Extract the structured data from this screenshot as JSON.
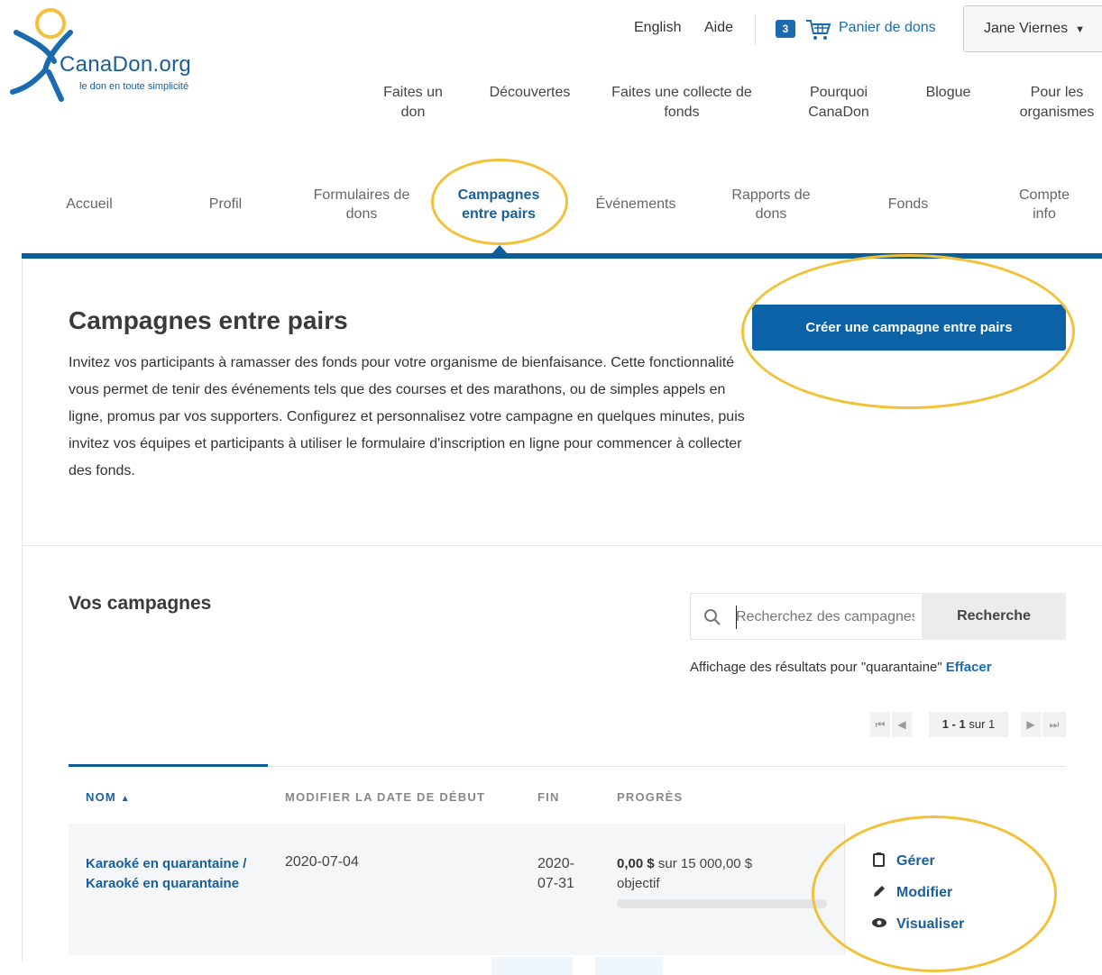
{
  "header": {
    "logo_name": "CanaDon.org",
    "logo_tagline": "le don en toute simplicité",
    "language_link": "English",
    "help_link": "Aide",
    "cart_count": "3",
    "cart_label": "Panier de dons",
    "user_name": "Jane Viernes",
    "user_caret": "▼",
    "main_nav": [
      {
        "label": "Faites un don"
      },
      {
        "label": "Découvertes"
      },
      {
        "label": "Faites une collecte de fonds"
      },
      {
        "label": "Pourquoi CanaDon"
      },
      {
        "label": "Blogue"
      },
      {
        "label": "Pour les organismes"
      }
    ]
  },
  "tabs": [
    {
      "label": "Accueil"
    },
    {
      "label": "Profil"
    },
    {
      "label": "Formulaires de dons"
    },
    {
      "label": "Campagnes entre pairs",
      "active": true
    },
    {
      "label": "Événements"
    },
    {
      "label": "Rapports de dons"
    },
    {
      "label": "Fonds"
    },
    {
      "label": "Compte info"
    }
  ],
  "page": {
    "title": "Campagnes entre pairs",
    "intro": "Invitez vos participants à ramasser des fonds pour votre organisme de bienfaisance. Cette fonctionnalité vous permet de tenir des événements tels que des courses et des marathons, ou de simples appels en ligne, promus par vos supporters. Configurez et personnalisez votre campagne en quelques minutes, puis invitez vos équipes et participants à utiliser le formulaire d'inscription en ligne pour commencer à collecter des fonds.",
    "create_button": "Créer une campagne entre pairs"
  },
  "campaigns": {
    "section_title": "Vos campagnes",
    "search_placeholder": "Recherchez des campagnes",
    "search_button": "Recherche",
    "results_text": "Affichage des résultats pour \"quarantaine\"",
    "results_clear": "Effacer",
    "pager": {
      "first": "⏮",
      "prev": "◀",
      "range": "1 - 1",
      "of_text": "sur 1",
      "next": "▶",
      "last": "⏭"
    },
    "columns": {
      "name": "NOM",
      "sort_indicator": "▲",
      "start": "MODIFIER LA DATE DE DÉBUT",
      "end": "FIN",
      "progress": "PROGRÈS"
    },
    "rows": [
      {
        "name": "Karaoké en quarantaine / Karaoké en quarantaine",
        "start_date": "2020-07-04",
        "end_date": "2020-07-31",
        "raised": "0,00 $",
        "goal_text": "sur 15 000,00 $ objectif",
        "progress_fraction": 0,
        "actions": {
          "manage": "Gérer",
          "edit": "Modifier",
          "view": "Visualiser"
        }
      }
    ]
  },
  "colors": {
    "brand_blue": "#0b62a6",
    "link_blue": "#1a5e9a",
    "highlight": "#f2c13a"
  }
}
